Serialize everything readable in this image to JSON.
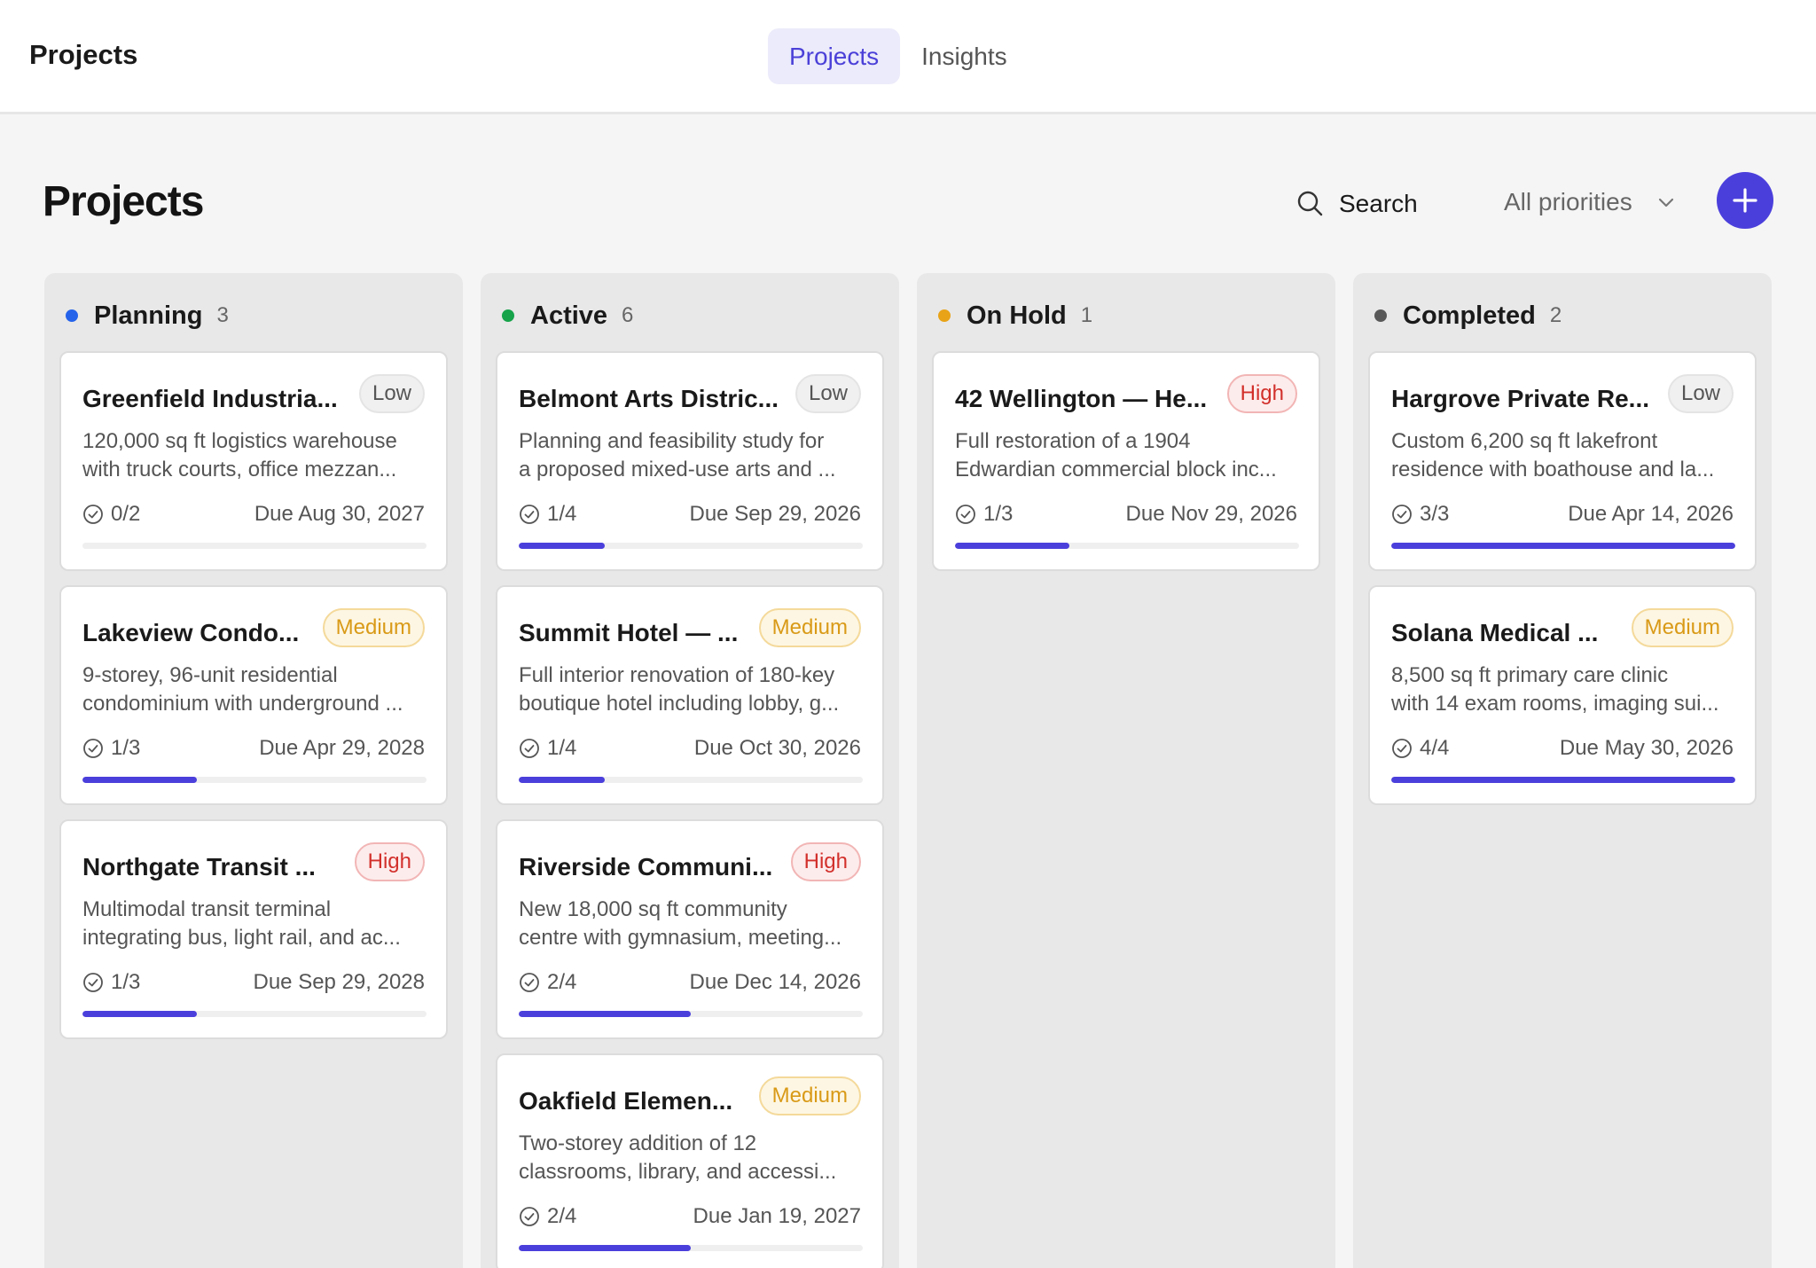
{
  "app": {
    "title": "Projects"
  },
  "nav": {
    "tabs": [
      {
        "label": "Projects",
        "active": true
      },
      {
        "label": "Insights",
        "active": false
      }
    ]
  },
  "header": {
    "title": "Projects",
    "search_label": "Search",
    "priority_filter": "All priorities"
  },
  "colors": {
    "accent": "#4b3fdc",
    "planning": "#2563eb",
    "active": "#16a34a",
    "on_hold": "#e8a317",
    "completed": "#595959"
  },
  "columns": [
    {
      "title": "Planning",
      "count": "3",
      "status_color": "#2563eb",
      "cards": [
        {
          "title": "Greenfield Industria...",
          "priority": "Low",
          "priority_level": "low",
          "desc_line1": "120,000 sq ft logistics warehouse",
          "desc_line2": "with truck courts, office mezzan...",
          "tasks": "0/2",
          "due": "Due Aug 30, 2027",
          "progress": 0
        },
        {
          "title": "Lakeview Condo...",
          "priority": "Medium",
          "priority_level": "medium",
          "desc_line1": "9-storey, 96-unit residential",
          "desc_line2": "condominium with underground ...",
          "tasks": "1/3",
          "due": "Due Apr 29, 2028",
          "progress": 0.333
        },
        {
          "title": "Northgate Transit ...",
          "priority": "High",
          "priority_level": "high",
          "desc_line1": "Multimodal transit terminal",
          "desc_line2": "integrating bus, light rail, and ac...",
          "tasks": "1/3",
          "due": "Due Sep 29, 2028",
          "progress": 0.333
        }
      ]
    },
    {
      "title": "Active",
      "count": "6",
      "status_color": "#16a34a",
      "cards": [
        {
          "title": "Belmont Arts Distric...",
          "priority": "Low",
          "priority_level": "low",
          "desc_line1": "Planning and feasibility study for",
          "desc_line2": "a proposed mixed-use arts and ...",
          "tasks": "1/4",
          "due": "Due Sep 29, 2026",
          "progress": 0.25
        },
        {
          "title": "Summit Hotel — ...",
          "priority": "Medium",
          "priority_level": "medium",
          "desc_line1": "Full interior renovation of 180-key",
          "desc_line2": "boutique hotel including lobby, g...",
          "tasks": "1/4",
          "due": "Due Oct 30, 2026",
          "progress": 0.25
        },
        {
          "title": "Riverside Communi...",
          "priority": "High",
          "priority_level": "high",
          "desc_line1": "New 18,000 sq ft community",
          "desc_line2": "centre with gymnasium, meeting...",
          "tasks": "2/4",
          "due": "Due Dec 14, 2026",
          "progress": 0.5
        },
        {
          "title": "Oakfield Elemen...",
          "priority": "Medium",
          "priority_level": "medium",
          "desc_line1": "Two-storey addition of 12",
          "desc_line2": "classrooms, library, and accessi...",
          "tasks": "2/4",
          "due": "Due Jan 19, 2027",
          "progress": 0.5
        }
      ]
    },
    {
      "title": "On Hold",
      "count": "1",
      "status_color": "#e8a317",
      "cards": [
        {
          "title": "42 Wellington — He...",
          "priority": "High",
          "priority_level": "high",
          "desc_line1": "Full restoration of a 1904",
          "desc_line2": "Edwardian commercial block inc...",
          "tasks": "1/3",
          "due": "Due Nov 29, 2026",
          "progress": 0.333
        }
      ]
    },
    {
      "title": "Completed",
      "count": "2",
      "status_color": "#595959",
      "cards": [
        {
          "title": "Hargrove Private Re...",
          "priority": "Low",
          "priority_level": "low",
          "desc_line1": "Custom 6,200 sq ft lakefront",
          "desc_line2": "residence with boathouse and la...",
          "tasks": "3/3",
          "due": "Due Apr 14, 2026",
          "progress": 1
        },
        {
          "title": "Solana Medical ...",
          "priority": "Medium",
          "priority_level": "medium",
          "desc_line1": "8,500 sq ft primary care clinic",
          "desc_line2": "with 14 exam rooms, imaging sui...",
          "tasks": "4/4",
          "due": "Due May 30, 2026",
          "progress": 1
        }
      ]
    }
  ]
}
